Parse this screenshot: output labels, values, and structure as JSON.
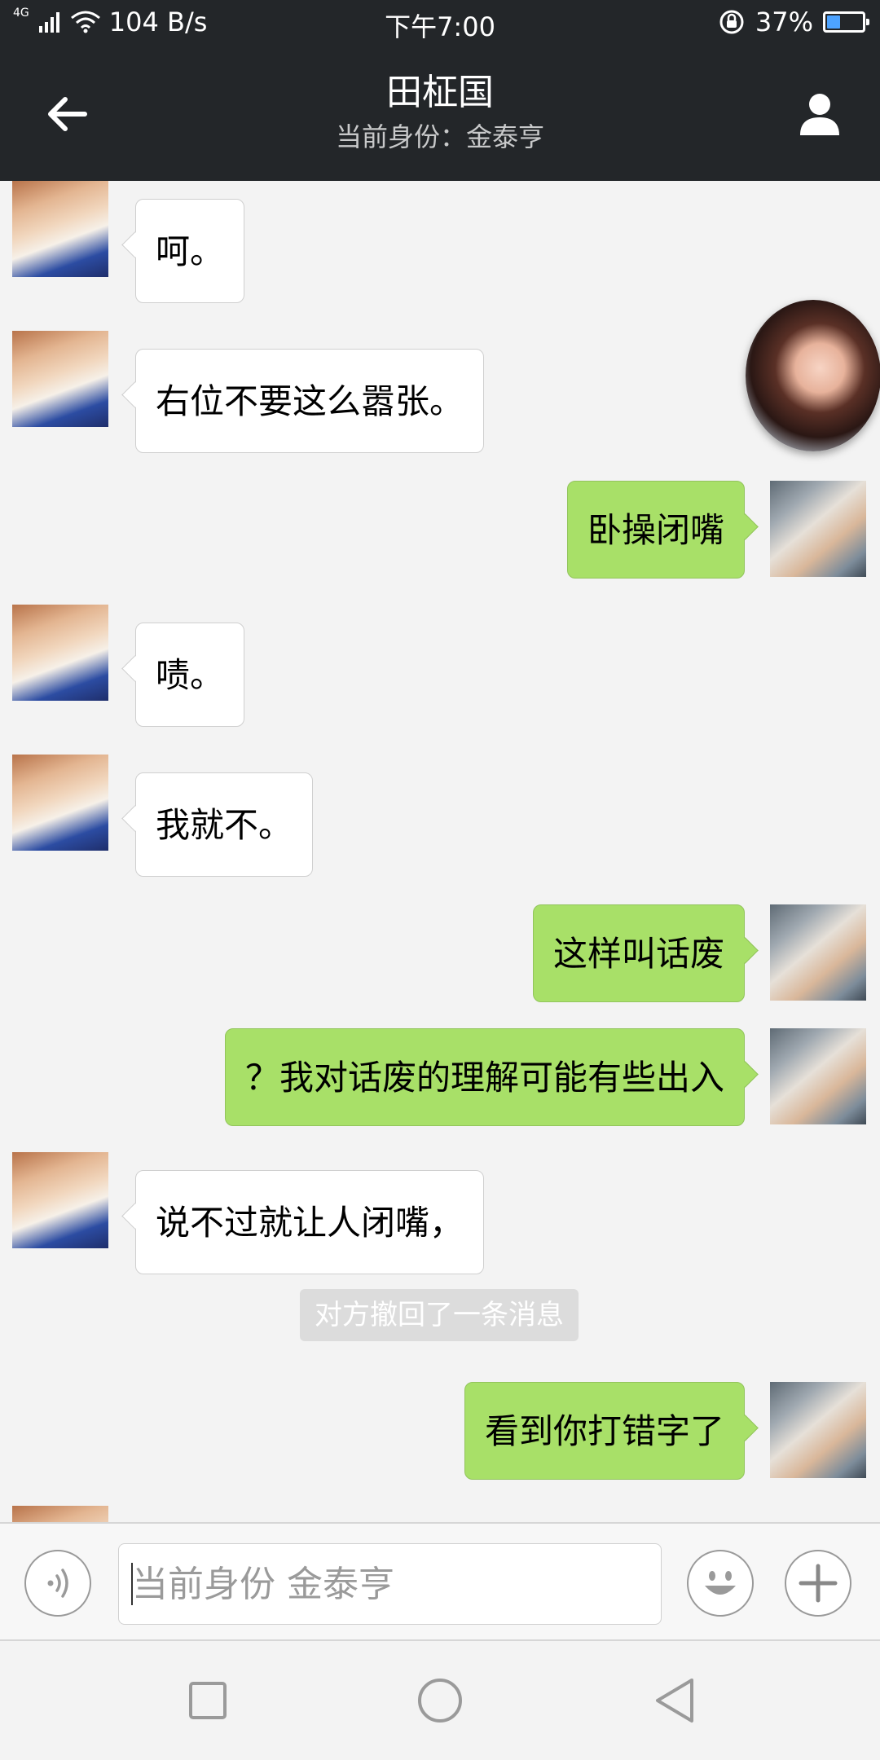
{
  "status_bar": {
    "network_type": "4G",
    "speed": "104 B/s",
    "time": "下午7:00",
    "battery_percent": "37%",
    "battery_level": 0.37
  },
  "header": {
    "title": "田柾国",
    "subtitle": "当前身份：金泰亨"
  },
  "messages": [
    {
      "side": "left",
      "text": "呵。"
    },
    {
      "side": "left",
      "text": "右位不要这么嚣张。"
    },
    {
      "side": "right",
      "text": "卧操闭嘴"
    },
    {
      "side": "left",
      "text": "啧。"
    },
    {
      "side": "left",
      "text": "我就不。"
    },
    {
      "side": "right",
      "text": "这样叫话废"
    },
    {
      "side": "right",
      "text": "？我对话废的理解可能有些出入"
    },
    {
      "side": "left",
      "text": "说不过就让人闭嘴，"
    },
    {
      "side": "system",
      "text": "对方撤回了一条消息"
    },
    {
      "side": "right",
      "text": "看到你打错字了"
    }
  ],
  "input_bar": {
    "placeholder": "当前身份 金泰亨"
  },
  "colors": {
    "header_bg": "#232629",
    "right_bubble": "#a8e068",
    "left_bubble": "#ffffff",
    "chat_bg": "#f3f3f3",
    "battery_fill": "#4da3ff"
  },
  "icons": {
    "back": "back-arrow-icon",
    "profile": "person-icon",
    "voice": "voice-icon",
    "emoji": "emoji-icon",
    "plus": "plus-icon",
    "nav_recent": "square-icon",
    "nav_home": "circle-icon",
    "nav_back": "triangle-icon"
  }
}
